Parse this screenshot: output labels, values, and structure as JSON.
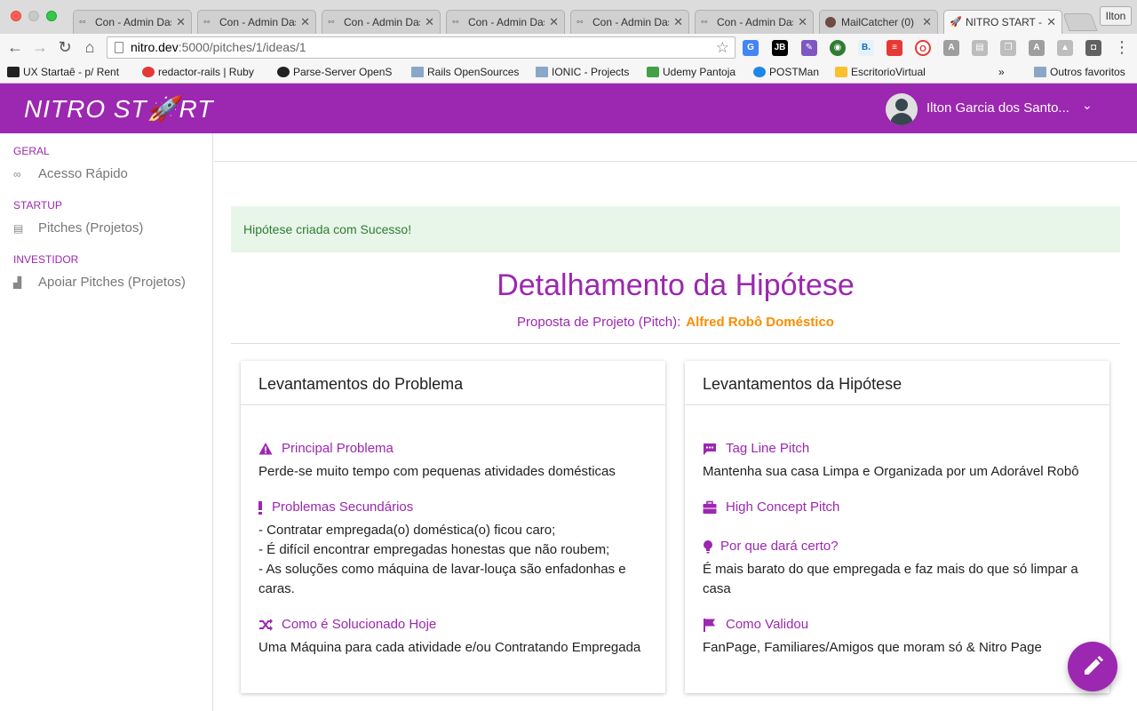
{
  "browser": {
    "tabs": [
      {
        "title": "Con - Admin Das",
        "icon": "glasses-icon"
      },
      {
        "title": "Con - Admin Das",
        "icon": "glasses-icon"
      },
      {
        "title": "Con - Admin Das",
        "icon": "glasses-icon"
      },
      {
        "title": "Con - Admin Das",
        "icon": "glasses-icon"
      },
      {
        "title": "Con - Admin Das",
        "icon": "glasses-icon"
      },
      {
        "title": "Con - Admin Das",
        "icon": "glasses-icon"
      },
      {
        "title": "MailCatcher (0)",
        "icon": "mailcatcher-icon"
      },
      {
        "title": "NITRO START - I",
        "icon": "rocket-icon"
      }
    ],
    "profile": "Ilton",
    "url_host": "nitro.dev",
    "url_path": ":5000/pitches/1/ideas/1",
    "bookmarks": [
      {
        "label": "UX Startaê - p/ Rent"
      },
      {
        "label": "redactor-rails | Ruby"
      },
      {
        "label": "Parse-Server OpenS"
      },
      {
        "label": "Rails OpenSources"
      },
      {
        "label": "IONIC - Projects"
      },
      {
        "label": "Udemy Pantoja"
      },
      {
        "label": "POSTMan"
      },
      {
        "label": "EscritorioVirtual"
      }
    ],
    "bookmarks_more": "»",
    "other_bookmarks": "Outros favoritos"
  },
  "app": {
    "logo_left": "NITRO ST",
    "logo_rocket": "🚀",
    "logo_right": "RT",
    "user_name": "Ilton Garcia dos Santo...",
    "brand_color": "#9c27b0",
    "accent_color": "#fb8c00"
  },
  "sidebar": {
    "sections": [
      {
        "header": "GERAL",
        "item": "Acesso Rápido",
        "icon": "link-icon"
      },
      {
        "header": "STARTUP",
        "item": "Pitches (Projetos)",
        "icon": "clipboard-icon"
      },
      {
        "header": "INVESTIDOR",
        "item": "Apoiar Pitches (Projetos)",
        "icon": "thumbs-up-icon"
      }
    ]
  },
  "main": {
    "alert": "Hipótese criada com Sucesso!",
    "title": "Detalhamento da Hipótese",
    "pitch_label": "Proposta de Projeto (Pitch):",
    "pitch_name": "Alfred Robô Doméstico"
  },
  "cards": {
    "problem": {
      "title": "Levantamentos do Problema",
      "sections": [
        {
          "heading": "Principal Problema",
          "icon": "warning-icon",
          "body": "Perde-se muito tempo com pequenas atividades domésticas"
        },
        {
          "heading": "Problemas Secundários",
          "icon": "exclamation-icon",
          "body": "- Contratar empregada(o) doméstica(o) ficou caro;\n- É difícil encontrar empregadas honestas que não roubem;\n- As soluções como máquina de lavar-louça são enfadonhas e caras."
        },
        {
          "heading": "Como é Solucionado Hoje",
          "icon": "shuffle-icon",
          "body": "Uma Máquina para cada atividade e/ou Contratando Empregada"
        }
      ]
    },
    "hypothesis": {
      "title": "Levantamentos da Hipótese",
      "sections": [
        {
          "heading": "Tag Line Pitch",
          "icon": "chat-icon",
          "body": "Mantenha sua casa Limpa e Organizada por um Adorável Robô"
        },
        {
          "heading": "High Concept Pitch",
          "icon": "briefcase-icon",
          "body": ""
        },
        {
          "heading": "Por que dará certo?",
          "icon": "lightbulb-icon",
          "body": "É mais barato do que empregada e faz mais do que só limpar a casa"
        },
        {
          "heading": "Como Validou",
          "icon": "flag-icon",
          "body": "FanPage, Familiares/Amigos que moram só & Nitro Page"
        }
      ]
    }
  }
}
